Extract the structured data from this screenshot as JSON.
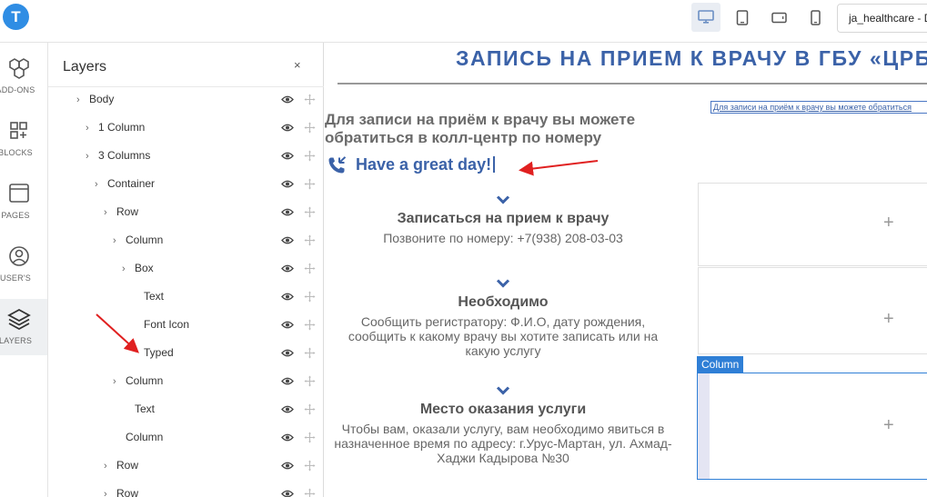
{
  "app": {
    "logo_letter": "T",
    "project_name": "ja_healthcare - D"
  },
  "devices": [
    "desktop-icon",
    "tablet-icon",
    "tablet-landscape-icon",
    "mobile-icon"
  ],
  "rail": [
    {
      "label": "ADD-ONS",
      "icon": "hexagons-icon"
    },
    {
      "label": "BLOCKS",
      "icon": "blocks-icon"
    },
    {
      "label": "PAGES",
      "icon": "page-icon"
    },
    {
      "label": "USER'S",
      "icon": "user-icon"
    },
    {
      "label": "LAYERS",
      "icon": "layers-icon",
      "active": true
    }
  ],
  "layers_panel": {
    "title": "Layers",
    "close": "×",
    "rows": [
      {
        "label": "Body",
        "has_children": true
      },
      {
        "label": "1 Column",
        "has_children": true
      },
      {
        "label": "3 Columns",
        "has_children": true
      },
      {
        "label": "Container",
        "has_children": true
      },
      {
        "label": "Row",
        "has_children": true
      },
      {
        "label": "Column",
        "has_children": true
      },
      {
        "label": "Box",
        "has_children": true
      },
      {
        "label": "Text",
        "has_children": false
      },
      {
        "label": "Font Icon",
        "has_children": false
      },
      {
        "label": "Typed",
        "has_children": false
      },
      {
        "label": "Column",
        "has_children": true
      },
      {
        "label": "Text",
        "has_children": false
      },
      {
        "label": "Column",
        "has_children": false
      },
      {
        "label": "Row",
        "has_children": true
      },
      {
        "label": "Row",
        "has_children": true
      }
    ]
  },
  "canvas": {
    "heading": "ЗАПИСЬ НА ПРИЕМ К ВРАЧУ В ГБУ «ЦРБ",
    "intro": "Для записи на приём к врачу вы можете обратиться в колл-центр по номеру",
    "typed": "Have a great day!",
    "small_link": "Для записи на приём к врачу вы можете обратиться",
    "sections": [
      {
        "title": "Записаться на прием к врачу",
        "text": "Позвоните по номеру: +7(938) 208-03-03"
      },
      {
        "title": "Необходимо",
        "text": "Сообщить регистратору: Ф.И.О, дату рождения, сообщить к какому врачу вы хотите записать или на какую услугу"
      },
      {
        "title": "Место оказания услуги",
        "text": "Чтобы вам, оказали услугу, вам необходимо явиться в назначенное время по адресу: г.Урус-Мартан, ул. Ахмад-Хаджи Кадырова №30"
      }
    ],
    "column_tag": "Column",
    "plus": "+"
  },
  "colors": {
    "accent": "#3b62a8",
    "selection": "#2f7fd6",
    "annotation": "#e02020"
  }
}
